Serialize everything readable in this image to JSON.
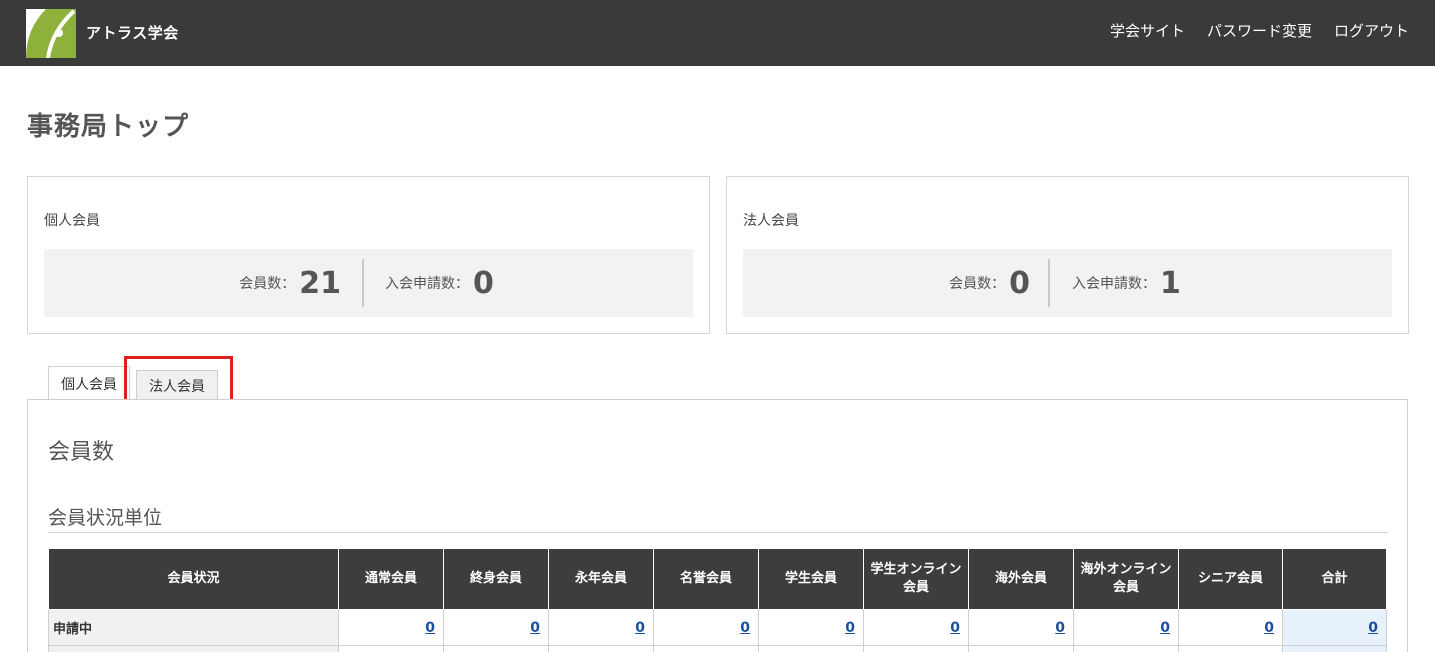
{
  "header": {
    "brand": "アトラス学会",
    "nav": [
      "学会サイト",
      "パスワード変更",
      "ログアウト"
    ],
    "bar_color": "#3a3a3a",
    "logo_color": "#8db13a"
  },
  "page_title": "事務局トップ",
  "summary": [
    {
      "title": "個人会員",
      "member_label": "会員数：",
      "member_count": "21",
      "applicant_label": "入会申請数：",
      "applicant_count": "0"
    },
    {
      "title": "法人会員",
      "member_label": "会員数：",
      "member_count": "0",
      "applicant_label": "入会申請数：",
      "applicant_count": "1"
    }
  ],
  "tabs": [
    "個人会員",
    "法人会員"
  ],
  "section_title": "会員数",
  "sub_title": "会員状況単位",
  "table": {
    "headers": [
      "会員状況",
      "通常会員",
      "終身会員",
      "永年会員",
      "名誉会員",
      "学生会員",
      "学生オンライン会員",
      "海外会員",
      "海外オンライン会員",
      "シニア会員",
      "合計"
    ],
    "rows": [
      {
        "label": "申請中",
        "values": [
          "0",
          "0",
          "0",
          "0",
          "0",
          "0",
          "0",
          "0",
          "0",
          "0"
        ]
      }
    ]
  }
}
